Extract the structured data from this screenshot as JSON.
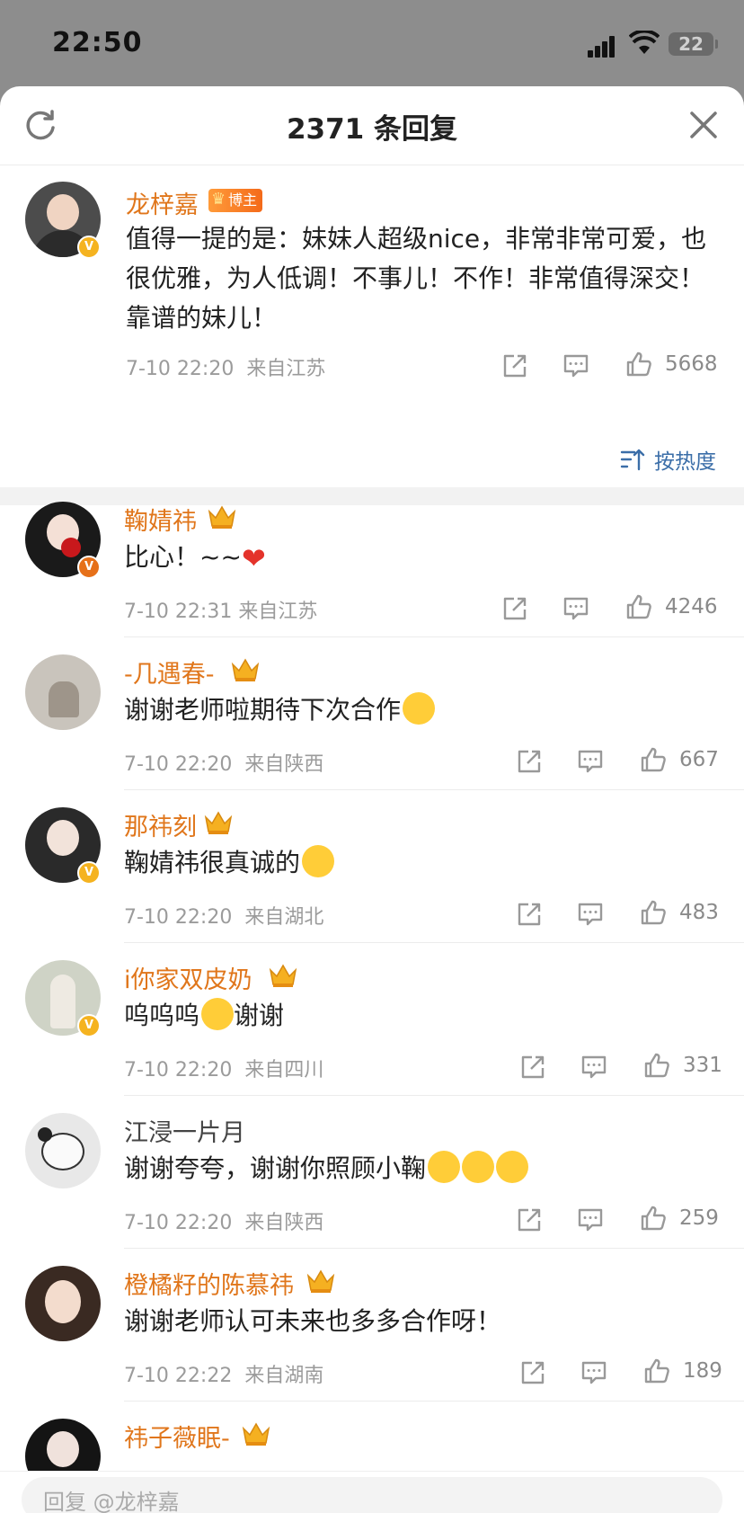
{
  "status_bar": {
    "time": "22:50",
    "battery": "22"
  },
  "header": {
    "title": "2371 条回复"
  },
  "top_comment": {
    "username": "龙梓嘉",
    "tag": "博主",
    "text": "值得一提的是：妹妹人超级nice，非常非常可爱，也很优雅，为人低调！不事儿！不作！非常值得深交！靠谱的妹儿！",
    "time": "7-10 22:20",
    "location": "来自江苏",
    "likes": "5668"
  },
  "sort": {
    "label": "按热度"
  },
  "comments": [
    {
      "username": "鞠婧祎",
      "text": "比心！~~",
      "time": "7-10 22:31",
      "location": "来自江苏",
      "likes": "4246"
    },
    {
      "username": "-几遇春-",
      "text": "谢谢老师啦期待下次合作",
      "time": "7-10 22:20",
      "location": "来自陕西",
      "likes": "667"
    },
    {
      "username": "那祎刻",
      "text": "鞠婧祎很真诚的",
      "time": "7-10 22:20",
      "location": "来自湖北",
      "likes": "483"
    },
    {
      "username": "i你家双皮奶",
      "text_a": "呜呜呜",
      "text_b": "谢谢",
      "time": "7-10 22:20",
      "location": "来自四川",
      "likes": "331"
    },
    {
      "username": "江浸一片月",
      "text": "谢谢夸夸，谢谢你照顾小鞠",
      "time": "7-10 22:20",
      "location": "来自陕西",
      "likes": "259"
    },
    {
      "username": "橙橘籽的陈慕祎",
      "text": "谢谢老师认可未来也多多合作呀！",
      "time": "7-10 22:22",
      "location": "来自湖南",
      "likes": "189"
    },
    {
      "username": "祎子薇眠-"
    }
  ],
  "input": {
    "placeholder": "回复 @龙梓嘉"
  },
  "colors": {
    "username": "#e0761b",
    "link": "#3b6ea8",
    "meta": "#9b9b9b"
  }
}
